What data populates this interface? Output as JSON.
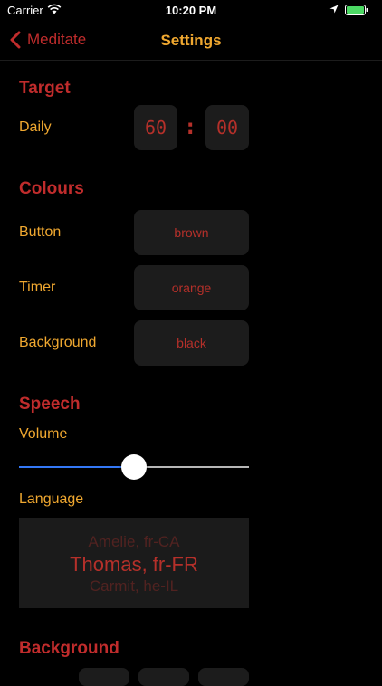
{
  "status_bar": {
    "carrier": "Carrier",
    "time": "10:20 PM"
  },
  "nav": {
    "back_label": "Meditate",
    "title": "Settings"
  },
  "target": {
    "header": "Target",
    "daily_label": "Daily",
    "hours": "60",
    "separator": ":",
    "minutes": "00"
  },
  "colours": {
    "header": "Colours",
    "rows": [
      {
        "label": "Button",
        "value": "brown"
      },
      {
        "label": "Timer",
        "value": "orange"
      },
      {
        "label": "Background",
        "value": "black"
      }
    ]
  },
  "speech": {
    "header": "Speech",
    "volume_label": "Volume",
    "volume_level": 0.5,
    "language_label": "Language",
    "language_options": [
      "Amelie, fr-CA",
      "Thomas, fr-FR",
      "Carmit, he-IL"
    ],
    "language_selected": "Thomas, fr-FR"
  },
  "background": {
    "header": "Background"
  },
  "colors": {
    "accent": "#c02c2c",
    "label": "#f0a830",
    "slider_active": "#3478f6"
  }
}
